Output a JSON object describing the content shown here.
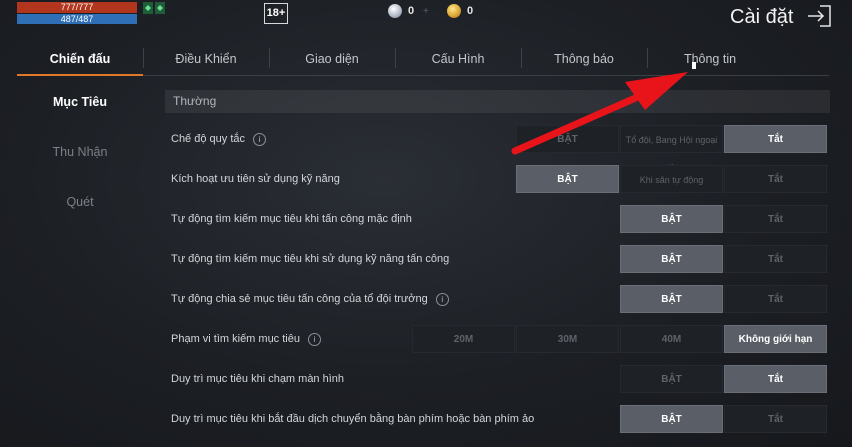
{
  "status": {
    "hp": "777/777",
    "mp": "487/487",
    "age_rating": "18+",
    "diamonds": "0",
    "gold": "0"
  },
  "header": {
    "title": "Cài đặt"
  },
  "tabs": [
    {
      "label": "Chiến đấu",
      "active": true
    },
    {
      "label": "Điều Khiển"
    },
    {
      "label": "Giao diện"
    },
    {
      "label": "Cấu Hình"
    },
    {
      "label": "Thông báo"
    },
    {
      "label": "Thông tin"
    }
  ],
  "side_menu": [
    {
      "label": "Mục Tiêu",
      "active": true
    },
    {
      "label": "Thu Nhận"
    },
    {
      "label": "Quét"
    }
  ],
  "section": {
    "title": "Thường"
  },
  "settings": [
    {
      "label": "Chế độ quy tắc",
      "info": true,
      "options": [
        {
          "label": "BẬT"
        },
        {
          "label": "Tổ đội, Bang Hội ngoại lệ",
          "small": true
        },
        {
          "label": "Tắt",
          "selected": true
        }
      ]
    },
    {
      "label": "Kích hoạt ưu tiên sử dụng kỹ năng",
      "options": [
        {
          "label": "BẬT",
          "selected": true
        },
        {
          "label": "Khi săn tự động",
          "small": true
        },
        {
          "label": "Tắt"
        }
      ]
    },
    {
      "label": "Tự động tìm kiếm mục tiêu khi tấn công mặc định",
      "options": [
        {
          "label": "BẬT",
          "selected": true
        },
        {
          "label": "Tắt"
        }
      ]
    },
    {
      "label": "Tự động tìm kiếm mục tiêu khi sử dụng kỹ năng tấn công",
      "options": [
        {
          "label": "BẬT",
          "selected": true
        },
        {
          "label": "Tắt"
        }
      ]
    },
    {
      "label": "Tự động chia sẻ mục tiêu tấn công của tổ đội trưởng",
      "info": true,
      "options": [
        {
          "label": "BẬT",
          "selected": true
        },
        {
          "label": "Tắt"
        }
      ]
    },
    {
      "label": "Phạm vi tìm kiếm mục tiêu",
      "info": true,
      "options": [
        {
          "label": "20M"
        },
        {
          "label": "30M"
        },
        {
          "label": "40M"
        },
        {
          "label": "Không giới hạn",
          "selected": true
        }
      ]
    },
    {
      "label": "Duy trì mục tiêu khi chạm màn hình",
      "options": [
        {
          "label": "BẬT"
        },
        {
          "label": "Tắt",
          "selected": true
        }
      ]
    },
    {
      "label": "Duy trì mục tiêu khi bắt đầu dịch chuyển bằng bàn phím hoặc bàn phím ảo",
      "options": [
        {
          "label": "BẬT",
          "selected": true
        },
        {
          "label": "Tắt"
        }
      ]
    }
  ],
  "icons": {
    "info": "i",
    "exit": "exit-icon",
    "buff": "buff-icon"
  },
  "colors": {
    "accent": "#e0782a",
    "arrow": "#e8141a",
    "hp": "#b1361d",
    "mp": "#2f6fb5"
  }
}
